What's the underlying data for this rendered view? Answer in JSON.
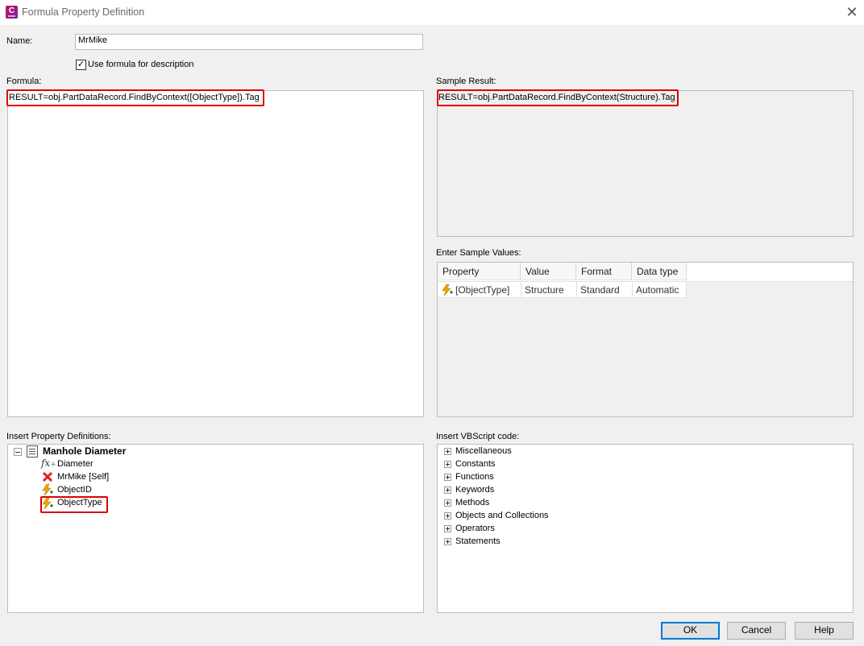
{
  "window": {
    "title": "Formula Property Definition",
    "close_glyph": "✕",
    "app_icon": "civil-3d-app-icon"
  },
  "name": {
    "label": "Name:",
    "value": "MrMike"
  },
  "use_formula": {
    "label": "Use formula for description",
    "checked": true,
    "check_glyph": "✓"
  },
  "formula": {
    "label": "Formula:",
    "text": "RESULT=obj.PartDataRecord.FindByContext([ObjectType]).Tag"
  },
  "sample_result": {
    "label": "Sample Result:",
    "text": "RESULT=obj.PartDataRecord.FindByContext(Structure).Tag"
  },
  "sample_values": {
    "label": "Enter Sample Values:",
    "columns": [
      "Property",
      "Value",
      "Format",
      "Data type"
    ],
    "rows": [
      {
        "property": "[ObjectType]",
        "value": "Structure",
        "format": "Standard",
        "data_type": "Automatic"
      }
    ]
  },
  "property_definitions": {
    "label": "Insert Property Definitions:",
    "root": "Manhole Diameter",
    "items": [
      {
        "label": "Diameter",
        "icon": "formula-fx-icon"
      },
      {
        "label": "MrMike [Self]",
        "icon": "red-x-icon"
      },
      {
        "label": "ObjectID",
        "icon": "auto-property-icon"
      },
      {
        "label": "ObjectType",
        "icon": "auto-property-icon"
      }
    ]
  },
  "vbscript": {
    "label": "Insert VBScript code:",
    "items": [
      "Miscellaneous",
      "Constants",
      "Functions",
      "Keywords",
      "Methods",
      "Objects and Collections",
      "Operators",
      "Statements"
    ]
  },
  "buttons": {
    "ok": "OK",
    "cancel": "Cancel",
    "help": "Help"
  },
  "colors": {
    "highlight": "#e00000",
    "default_button_border": "#0078d7",
    "title_text": "#6a6a6a"
  }
}
